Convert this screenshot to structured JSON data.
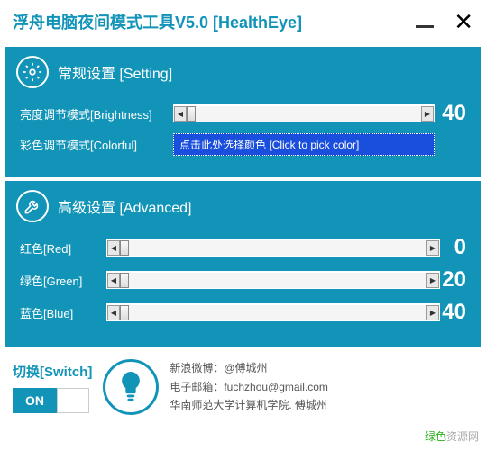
{
  "title": "浮舟电脑夜间模式工具V5.0 [HealthEye]",
  "setting": {
    "header": "常规设置 [Setting]",
    "brightness_label": "亮度调节模式[Brightness]",
    "brightness_value": "40",
    "colorful_label": "彩色调节模式[Colorful]",
    "colorpick_text": "点击此处选择颜色 [Click to pick color]"
  },
  "advanced": {
    "header": "高级设置 [Advanced]",
    "red_label": "红色[Red]",
    "red_value": "0",
    "green_label": "绿色[Green]",
    "green_value": "20",
    "blue_label": "蓝色[Blue]",
    "blue_value": "40"
  },
  "footer": {
    "switch_label": "切换[Switch]",
    "toggle_state": "ON",
    "contact_weibo": "新浪微博：@傅城州",
    "contact_email": "电子邮箱：fuchzhou@gmail.com",
    "contact_school": "华南师范大学计算机学院. 傅城州"
  },
  "watermark": {
    "green": "绿色",
    "rest": "资源网"
  }
}
